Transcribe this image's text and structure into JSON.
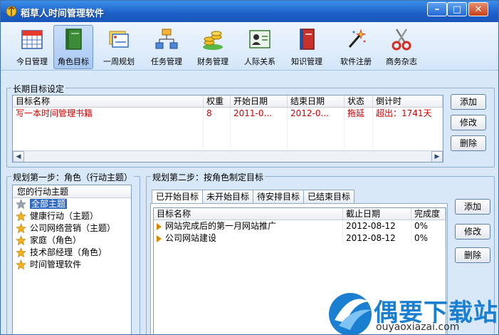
{
  "window": {
    "title": "稻草人时间管理软件"
  },
  "toolbar": {
    "items": [
      {
        "label": "今日管理"
      },
      {
        "label": "角色目标"
      },
      {
        "label": "一周规划"
      },
      {
        "label": "任务管理"
      },
      {
        "label": "财务管理"
      },
      {
        "label": "人际关系"
      },
      {
        "label": "知识管理"
      },
      {
        "label": "软件注册"
      },
      {
        "label": "商务杂志"
      }
    ],
    "active_index": 1
  },
  "long_term": {
    "legend": "长期目标设定",
    "columns": [
      "目标名称",
      "权重",
      "开始日期",
      "结束日期",
      "状态",
      "倒计时"
    ],
    "rows": [
      {
        "name": "写一本时间管理书籍",
        "weight": "8",
        "start": "2011-0...",
        "end": "2012-0...",
        "status": "拖延",
        "countdown": "超出：1741天"
      }
    ],
    "buttons": {
      "add": "添加",
      "edit": "修改",
      "delete": "删除"
    }
  },
  "step1": {
    "legend": "规划第一步：角色（行动主题）",
    "header": "您的行动主题",
    "items": [
      {
        "label": "全部主题"
      },
      {
        "label": "健康行动（主题）"
      },
      {
        "label": "公司网络营销（主题）"
      },
      {
        "label": "家庭（角色）"
      },
      {
        "label": "技术部经理（角色）"
      },
      {
        "label": "时间管理软件"
      }
    ]
  },
  "step2": {
    "legend": "规划第二步：按角色制定目标",
    "tabs": [
      {
        "label": "已开始目标"
      },
      {
        "label": "未开始目标"
      },
      {
        "label": "待安排目标"
      },
      {
        "label": "已结束目标"
      }
    ],
    "columns": [
      "目标名称",
      "截止日期",
      "完成度"
    ],
    "rows": [
      {
        "name": "网站完成后的第一月网站推广",
        "deadline": "2012-08-12",
        "progress": "0%"
      },
      {
        "name": "公司网站建设",
        "deadline": "2012-08-12",
        "progress": "0%"
      }
    ],
    "buttons": {
      "add": "添加",
      "edit": "修改",
      "delete": "删除"
    }
  },
  "watermark": {
    "title": "偶要下载站",
    "sub": "ouyaoxiazai.com"
  }
}
